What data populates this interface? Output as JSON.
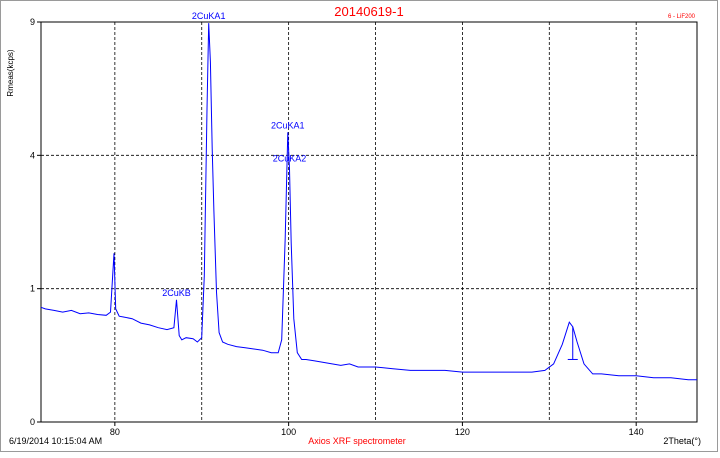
{
  "chart_data": {
    "type": "line",
    "title": "20140619-1",
    "tag": "6 - LiF200",
    "xlabel": "2Theta(°)",
    "ylabel": "Rmeas(kcps)",
    "xlim": [
      71.5,
      147
    ],
    "ylim": [
      0,
      9
    ],
    "y_scale": "sqrt",
    "x_ticks": [
      80,
      100,
      120,
      140
    ],
    "y_ticks": [
      0,
      1,
      4,
      9
    ],
    "grid": true,
    "footer_left": "6/19/2014 10:15:04 AM",
    "footer_center": "Axios XRF spectrometer",
    "series": [
      {
        "x": [
          71.5,
          72,
          73,
          74,
          75,
          76,
          77,
          78,
          79,
          79.5,
          79.9,
          80.1,
          80.5,
          81,
          82,
          83,
          84,
          85,
          86,
          86.8,
          87.1,
          87.4,
          87.7,
          88.2,
          89,
          89.5,
          90,
          90.3,
          90.6,
          90.8,
          91.0,
          91.2,
          91.4,
          91.7,
          92,
          92.4,
          93,
          94,
          95,
          96,
          97,
          98,
          98.8,
          99.2,
          99.6,
          99.9,
          100.1,
          100.3,
          100.6,
          101,
          101.5,
          102,
          103,
          104,
          105,
          106,
          107,
          108,
          109,
          110,
          112,
          114,
          116,
          118,
          120,
          122,
          124,
          126,
          128,
          129.5,
          130.5,
          131.5,
          132.3,
          132.7,
          133.2,
          134,
          135,
          136,
          138,
          140,
          142,
          144,
          146,
          147
        ],
        "y": [
          0.74,
          0.72,
          0.7,
          0.68,
          0.7,
          0.66,
          0.67,
          0.65,
          0.64,
          0.68,
          1.6,
          0.72,
          0.63,
          0.62,
          0.6,
          0.55,
          0.53,
          0.5,
          0.48,
          0.5,
          0.84,
          0.42,
          0.38,
          0.4,
          0.39,
          0.36,
          0.4,
          1.2,
          5.5,
          8.95,
          7.3,
          4.2,
          2.5,
          0.95,
          0.45,
          0.36,
          0.34,
          0.32,
          0.31,
          0.3,
          0.29,
          0.27,
          0.27,
          0.38,
          1.9,
          4.72,
          3.6,
          1.8,
          0.6,
          0.27,
          0.22,
          0.22,
          0.21,
          0.2,
          0.19,
          0.18,
          0.19,
          0.17,
          0.17,
          0.17,
          0.16,
          0.15,
          0.15,
          0.15,
          0.14,
          0.14,
          0.14,
          0.14,
          0.14,
          0.15,
          0.19,
          0.34,
          0.56,
          0.51,
          0.36,
          0.19,
          0.13,
          0.13,
          0.12,
          0.12,
          0.11,
          0.11,
          0.1,
          0.1
        ]
      }
    ],
    "peak_labels": [
      {
        "text": "2CuKB",
        "x": 87.1,
        "y": 0.84
      },
      {
        "text": "2CuKA1",
        "x": 90.8,
        "y": 8.95
      },
      {
        "text": "2CuKA1",
        "x": 99.9,
        "y": 4.72
      },
      {
        "text": "2CuKA2",
        "x": 100.1,
        "y": 3.7
      }
    ]
  }
}
